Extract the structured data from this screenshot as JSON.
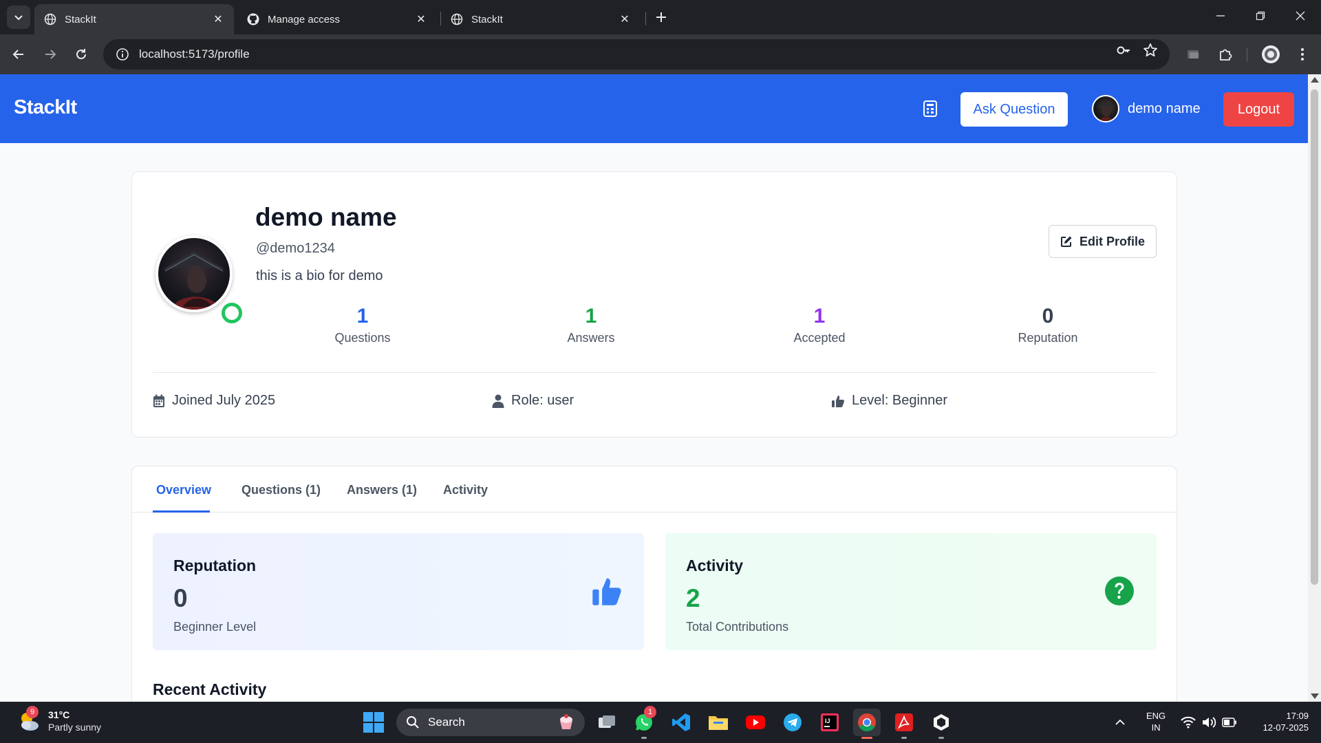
{
  "browser": {
    "tabs": [
      {
        "title": "StackIt",
        "active": true
      },
      {
        "title": "Manage access",
        "active": false
      },
      {
        "title": "StackIt",
        "active": false
      }
    ],
    "url": "localhost:5173/profile"
  },
  "header": {
    "brand": "StackIt",
    "ask_button": "Ask Question",
    "user_name": "demo name",
    "logout_button": "Logout"
  },
  "profile": {
    "name": "demo name",
    "handle": "@demo1234",
    "bio": "this is a bio for demo",
    "edit_button": "Edit Profile",
    "stats": [
      {
        "value": "1",
        "label": "Questions",
        "color": "#2563eb"
      },
      {
        "value": "1",
        "label": "Answers",
        "color": "#16a34a"
      },
      {
        "value": "1",
        "label": "Accepted",
        "color": "#9333ea"
      },
      {
        "value": "0",
        "label": "Reputation",
        "color": "#374151"
      }
    ],
    "meta": {
      "joined": "Joined July 2025",
      "role": "Role: user",
      "level": "Level: Beginner"
    }
  },
  "tabs": [
    {
      "label": "Overview",
      "active": true
    },
    {
      "label": "Questions (1)",
      "active": false
    },
    {
      "label": "Answers (1)",
      "active": false
    },
    {
      "label": "Activity",
      "active": false
    }
  ],
  "overview": {
    "reputation": {
      "title": "Reputation",
      "value": "0",
      "subtitle": "Beginner Level",
      "icon": "thumbs-up-icon",
      "color": "#2563eb"
    },
    "activity": {
      "title": "Activity",
      "value": "2",
      "subtitle": "Total Contributions",
      "icon": "question-circle-icon",
      "color": "#16a34a"
    },
    "recent_heading": "Recent Activity"
  },
  "taskbar": {
    "weather": {
      "temp": "31°C",
      "condition": "Partly sunny",
      "badge": "9"
    },
    "search_placeholder": "Search",
    "whatsapp_badge": "1",
    "language": [
      "ENG",
      "IN"
    ],
    "time": "17:09",
    "date": "12-07-2025"
  },
  "colors": {
    "brand_blue": "#2563eb",
    "logout_red": "#ef4444",
    "online_green": "#22c55e"
  }
}
